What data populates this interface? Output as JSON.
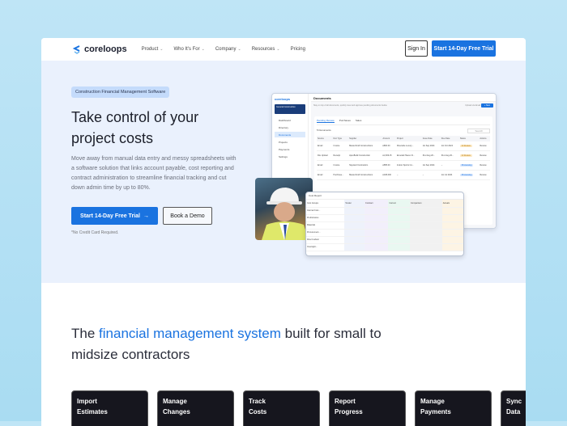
{
  "nav": {
    "brand": "coreloops",
    "menu": [
      "Product",
      "Who It's For",
      "Company",
      "Resources",
      "Pricing"
    ],
    "menu_has_chevron": [
      true,
      true,
      true,
      true,
      false
    ],
    "sign_in": "Sign In",
    "trial": "Start 14-Day Free Trial"
  },
  "hero": {
    "tag": "Construction Financial Management Software",
    "title": "Take control of your project costs",
    "description": "Move away from manual data entry and messy spreadsheets with a software solution that links account payable, cost reporting and contract administration to streamline financial tracking and cut down admin time by up to 80%.",
    "cta": "Start 14-Day Free Trial",
    "cta_icon": "arrow-right-icon",
    "demo": "Book a Demo",
    "note": "*No Credit Card Required."
  },
  "app": {
    "brand": "coreloops",
    "org": "General Construction",
    "sidebar": [
      "Dashboard",
      "Directory",
      "Documents",
      "Projects",
      "Payments",
      "Settings"
    ],
    "page_title": "Documents",
    "subtitle": "Stay on top of all documents, quickly view and approve pending documents below.",
    "upload": "Upload via Email",
    "new": "+ New",
    "tabs": [
      "Pending Review",
      "Purchases",
      "Sales"
    ],
    "count": "5 Documents",
    "search": "Search",
    "columns": [
      "Source",
      "Doc Type",
      "Supplier",
      "Amount",
      "Project",
      "Issue Date",
      "Due Date",
      "Status",
      "Actions"
    ],
    "rows": [
      [
        "Email",
        "Invoice",
        "MasterCraft Constructions",
        "£800.00",
        "Riverside Luxury...",
        "1st Sep 2024",
        "1st Oct 2024",
        "In Review",
        "Review"
      ],
      [
        "File Upload",
        "Receipt",
        "ApexBuild Construction",
        "£1,609.15",
        "Emerald Haven R...",
        "31st Aug 20...",
        "31st Aug 20...",
        "In Review",
        "Review"
      ],
      [
        "Email",
        "Invoice",
        "Skyward Contractors",
        "£585.00",
        "Indoor Sports Co...",
        "1st Sep 2024",
        "–",
        "Processing",
        "Review"
      ],
      [
        "Email",
        "Purchase...",
        "MasterCraft Constructions",
        "£108,000",
        "–",
        "–",
        "1st Jul 2024",
        "Processing",
        "Review"
      ]
    ]
  },
  "report": {
    "title": "Cost Report",
    "groups": [
      "Cost Groups",
      "Tender",
      "Contract",
      "Current",
      "Comparison",
      "Actuals"
    ],
    "rows": [
      "Internal Cost...",
      "Preliminaries",
      "Materials",
      "Procurement...",
      "Direct Labour",
      "Oversight..."
    ]
  },
  "section": {
    "title_pre": "The ",
    "title_highlight": "financial management system",
    "title_post": " built for small to midsize contractors"
  },
  "features": [
    [
      "Import",
      "Estimates"
    ],
    [
      "Manage",
      "Changes"
    ],
    [
      "Track",
      "Costs"
    ],
    [
      "Report",
      "Progress"
    ],
    [
      "Manage",
      "Payments"
    ],
    [
      "Sync",
      "Data"
    ]
  ],
  "colors": {
    "accent": "#1a73e0",
    "hero_bg": "#eaf1fd"
  }
}
